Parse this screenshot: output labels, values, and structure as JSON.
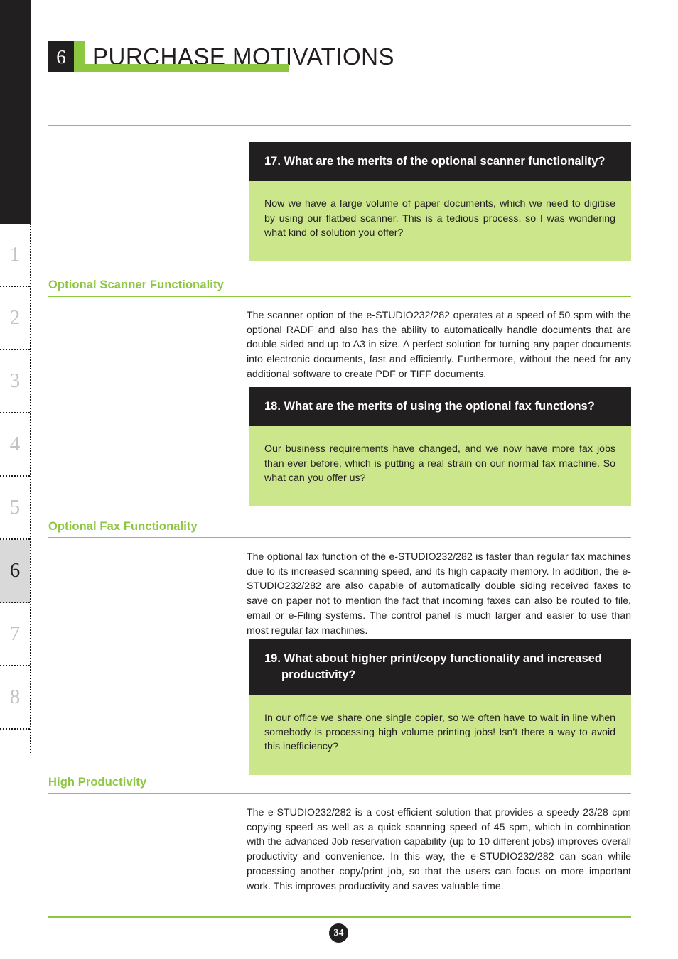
{
  "header": {
    "chapter_number": "6",
    "title": "PURCHASE MOTIVATIONS"
  },
  "sidebar": {
    "tabs": [
      {
        "label": "1",
        "active": false
      },
      {
        "label": "2",
        "active": false
      },
      {
        "label": "3",
        "active": false
      },
      {
        "label": "4",
        "active": false
      },
      {
        "label": "5",
        "active": false
      },
      {
        "label": "6",
        "active": true
      },
      {
        "label": "7",
        "active": false
      },
      {
        "label": "8",
        "active": false
      }
    ]
  },
  "colors": {
    "accent_green": "#8dc63f",
    "panel_green": "#cbe68b",
    "dark": "#221f20",
    "tab_active_bg": "#d9d9d9",
    "tab_inactive_text": "#c3c3c3"
  },
  "qa": [
    {
      "question": "17. What are the merits of the optional scanner functionality?",
      "answer": "Now we have a large volume of paper documents, which we need to digitise by using our flatbed scanner. This is a tedious process, so I was wondering what kind of solution you offer?"
    },
    {
      "question": "18. What are the merits of using the optional fax functions?",
      "answer": "Our business requirements have changed, and we now have more fax jobs than ever before, which is putting a real strain on our normal fax machine. So what can you offer us?"
    },
    {
      "question": "19. What about higher print/copy functionality and increased productivity?",
      "answer": "In our office we share one single copier, so we often have to wait in line when somebody is processing high volume printing jobs! Isn’t there a way to avoid this inefficiency?"
    }
  ],
  "sections": [
    {
      "title": "Optional Scanner Functionality",
      "body": "The scanner option of the e-STUDIO232/282 operates at a speed of 50 spm with the optional RADF and also has the ability to automatically handle documents that are double sided and up to A3 in size. A perfect solution for turning any paper documents into electronic documents, fast and efficiently. Furthermore, without the need for any additional software to create PDF or TIFF documents."
    },
    {
      "title": "Optional Fax Functionality",
      "body": "The optional fax function of the e-STUDIO232/282 is faster than regular fax machines due to its increased scanning speed, and its high capacity memory. In addition, the e-STUDIO232/282 are also capable of automatically double siding received faxes to save on paper not to mention the fact that incoming faxes can also be routed to file, email or e-Filing systems. The control panel is much larger and easier to use than most regular fax machines."
    },
    {
      "title": "High Productivity",
      "body": "The e-STUDIO232/282 is a cost-efficient solution that provides a speedy 23/28 cpm copying speed as well as a quick scanning speed of 45 spm, which in combination with the advanced Job reservation capability (up to 10 different jobs) improves overall productivity and convenience. In this way, the e-STUDIO232/282 can scan while processing another copy/print job, so that the users can focus on more important work. This improves productivity and saves valuable time."
    }
  ],
  "footer": {
    "page_number": "34"
  }
}
